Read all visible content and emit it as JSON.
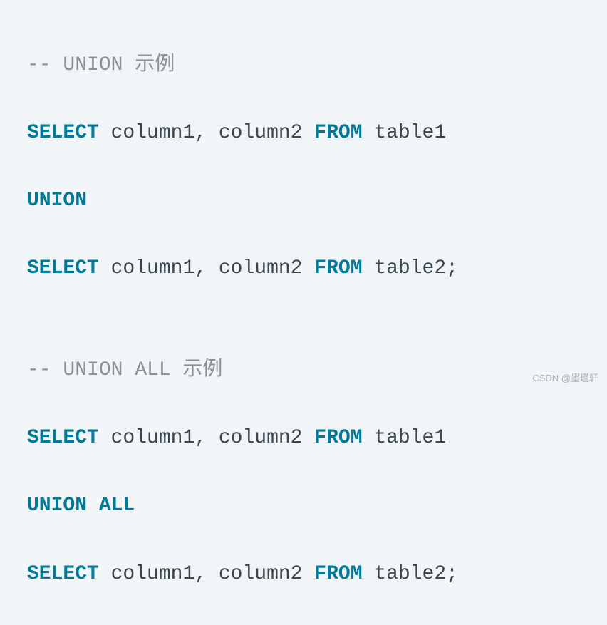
{
  "code": {
    "line1_comment": "-- UNION 示例",
    "line2_kw1": "SELECT",
    "line2_p1": " column1, column2 ",
    "line2_kw2": "FROM",
    "line2_p2": " table1",
    "line3_kw1": "UNION",
    "line4_kw1": "SELECT",
    "line4_p1": " column1, column2 ",
    "line4_kw2": "FROM",
    "line4_p2": " table2;",
    "line6_comment": "-- UNION ALL 示例",
    "line7_kw1": "SELECT",
    "line7_p1": " column1, column2 ",
    "line7_kw2": "FROM",
    "line7_p2": " table1",
    "line8_kw1": "UNION ALL",
    "line9_kw1": "SELECT",
    "line9_p1": " column1, column2 ",
    "line9_kw2": "FROM",
    "line9_p2": " table2;"
  },
  "watermark": "CSDN @墨瑾轩"
}
